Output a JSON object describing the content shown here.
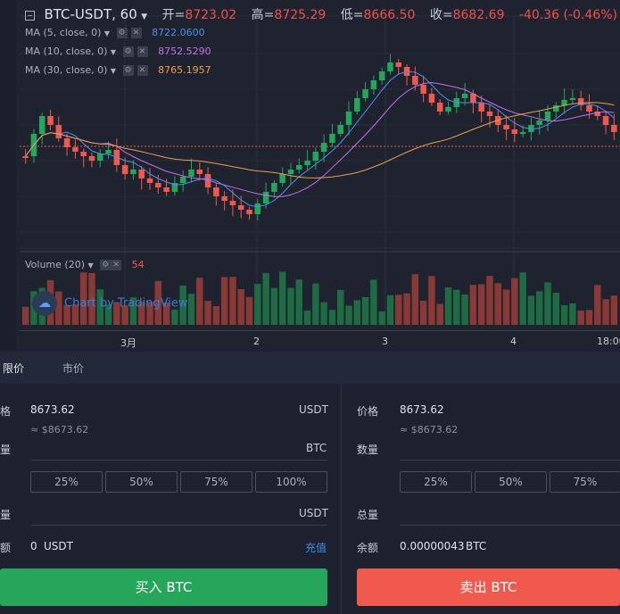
{
  "header": {
    "symbol": "BTC-USDT, 60",
    "open_label": "开=",
    "open": "8723.02",
    "high_label": "高=",
    "high": "8725.29",
    "low_label": "低=",
    "low": "8666.50",
    "close_label": "收=",
    "close": "8682.69",
    "change": "-40.36 (-0.46%)"
  },
  "indicators": [
    {
      "label": "MA (5, close, 0)",
      "value": "8722.0600",
      "color": "#4f8fe8"
    },
    {
      "label": "MA (10, close, 0)",
      "value": "8752.5290",
      "color": "#c070e8"
    },
    {
      "label": "MA (30, close, 0)",
      "value": "8765.1957",
      "color": "#e8a050"
    }
  ],
  "volume": {
    "label": "Volume (20)",
    "value": "54"
  },
  "watermark": "Chart by TradingView",
  "xaxis": [
    "3月",
    "2",
    "3",
    "4",
    "18:00"
  ],
  "colors": {
    "up": "#26a65b",
    "down": "#f05a4e",
    "bg": "#1f2330"
  },
  "tabs": [
    "限价",
    "市价"
  ],
  "buy": {
    "price_label": "格",
    "price": "8673.62",
    "price_unit": "USDT",
    "approx": "≈ $8673.62",
    "amount_label": "量",
    "amount_unit": "BTC",
    "percents": [
      "25%",
      "50%",
      "75%",
      "100%"
    ],
    "total_label": "量",
    "total_unit": "USDT",
    "balance_label": "额",
    "balance": "0",
    "balance_unit": "USDT",
    "deposit": "充值",
    "button": "买入 BTC"
  },
  "sell": {
    "price_label": "价格",
    "price": "8673.62",
    "approx": "≈ $8673.62",
    "amount_label": "数量",
    "percents": [
      "25%",
      "50%",
      "75%"
    ],
    "total_label": "总量",
    "balance_label": "余额",
    "balance": "0.00000043",
    "balance_unit": "BTC",
    "button": "卖出 BTC"
  }
}
